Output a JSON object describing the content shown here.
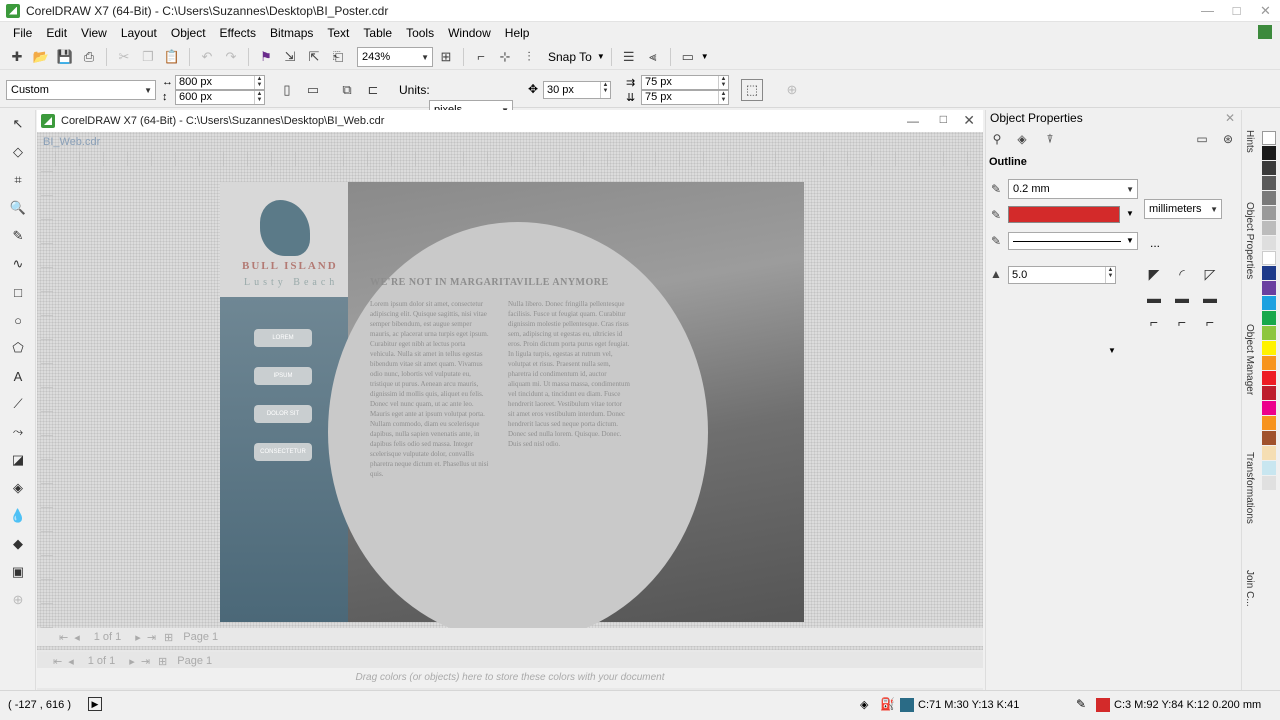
{
  "window": {
    "title": "CorelDRAW X7 (64-Bit) - C:\\Users\\Suzannes\\Desktop\\BI_Poster.cdr",
    "controls": [
      "—",
      "□",
      "✕"
    ]
  },
  "menu": [
    "File",
    "Edit",
    "View",
    "Layout",
    "Object",
    "Effects",
    "Bitmaps",
    "Text",
    "Table",
    "Tools",
    "Window",
    "Help"
  ],
  "toolbar": {
    "zoom": "243%",
    "snap_to": "Snap To"
  },
  "property_bar": {
    "page_preset": "Custom",
    "width": "800 px",
    "height": "600 px",
    "units_label": "Units:",
    "units": "pixels",
    "nudge": "30 px",
    "dup_x": "75 px",
    "dup_y": "75 px"
  },
  "document": {
    "title": "CorelDRAW X7 (64-Bit) - C:\\Users\\Suzannes\\Desktop\\BI_Web.cdr",
    "tab": "BI_Web.cdr",
    "poster": {
      "logo_line1": "BULL ISLAND",
      "logo_line2": "Lusty Beach",
      "headline": "WE'RE NOT IN MARGARITAVILLE ANYMORE",
      "nav": [
        "LOREM",
        "IPSUM",
        "DOLOR SIT",
        "CONSECTETUR"
      ],
      "col1": "Lorem ipsum dolor sit amet, consectetur adipiscing elit. Quisque sagittis, nisi vitae semper bibendum, est augue semper mauris, ac placerat urna turpis eget ipsum. Curabitur eget nibh at lectus porta vehicula. Nulla sit amet in tellus egestas bibendum vitae sit amet quam. Vivamus odio nunc, lobortis vel vulputate eu, tristique ut purus. Aenean arcu mauris, dignissim id mollis quis, aliquet eu felis. Donec vel nunc quam, ut ac ante leo. Mauris eget ante at ipsum volutpat porta. Nullam commodo, diam eu scelerisque dapibus, nulla sapien venenatis ante, in dapibus felis odio sed massa. Integer scelerisque vulputate dolor, convallis pharetra neque dictum et. Phasellus ut nisi quis.",
      "col2": "Nulla libero. Donec fringilla pellentesque facilisis. Fusce ut feugiat quam. Curabitur dignissim molestie pellentesque. Cras risus sem, adipiscing ut egestas eu, ultricies id eros. Proin dictum porta purus eget feugiat. In ligula turpis, egestas at rutrum vel, volutpat et risus. Praesent nulla sem, pharetra id condimentum id, auctor aliquam mi. Ut massa massa, condimentum vel tincidunt a, tincidunt eu diam. Fusce hendrerit laoreet. Vestibulum vitae tortor sit amet eros vestibulum interdum. Donec hendrerit lacus sed neque porta dictum. Donec sed nulla lorem. Quisque. Donec. Duis sed nisl odio."
    },
    "page_nav": "1 of 1",
    "page_tab": "Page 1",
    "palette_hint": "Drag colors (or objects) here to store these colors with your document"
  },
  "object_properties": {
    "title": "Object Properties",
    "section": "Outline",
    "width": "0.2 mm",
    "units": "millimeters",
    "miter": "5.0",
    "more": "...",
    "outline_color": "#d32a2a"
  },
  "docker_tabs": [
    "Hints",
    "Object Properties",
    "Object Manager",
    "Transformations",
    "Join C..."
  ],
  "palette_colors": [
    "#ffffff",
    "#1a1a1a",
    "#3a3a3a",
    "#5a5a5a",
    "#7a7a7a",
    "#9a9a9a",
    "#bcbcbc",
    "#dedede",
    "#ffffff",
    "#1e3a8a",
    "#6a3fa0",
    "#1da1e0",
    "#17a84b",
    "#8dc63f",
    "#fff200",
    "#f7941d",
    "#ed1c24",
    "#be1e2d",
    "#ec008c",
    "#f7931e",
    "#a0522d",
    "#f5deb3",
    "#c8e6f0",
    "#e0e0e0"
  ],
  "status": {
    "coords": "( -127 , 616 )",
    "fill_label": "C:71 M:30 Y:13 K:41",
    "fill_color": "#2a6b86",
    "outline_label": "C:3 M:92 Y:84 K:12  0.200 mm",
    "outline_color": "#d32a2a"
  }
}
